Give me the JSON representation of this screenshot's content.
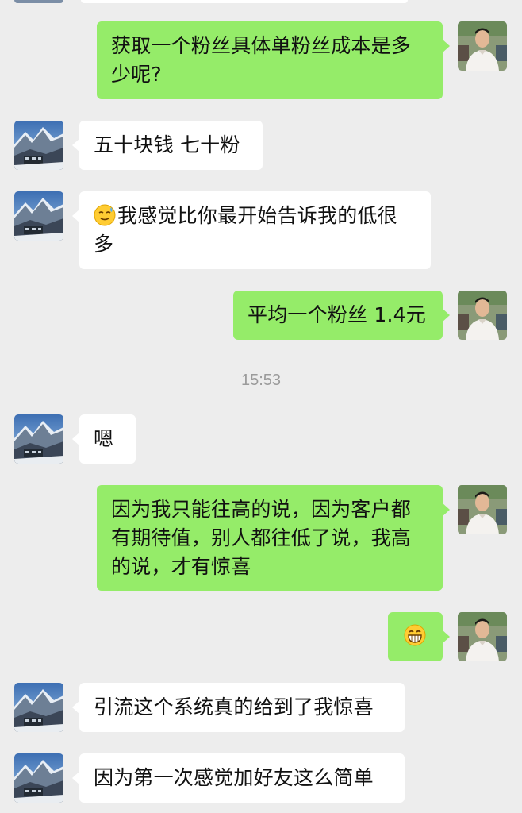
{
  "timestamp": "15:53",
  "messages": [
    {
      "side": "out",
      "text": "获取一个粉丝具体单粉丝成本是多少呢?"
    },
    {
      "side": "in",
      "text": "五十块钱 七十粉"
    },
    {
      "side": "in",
      "emoji": "sweat-smile-emoji",
      "text": "我感觉比你最开始告诉我的低很多"
    },
    {
      "side": "out",
      "text": "平均一个粉丝 1.4元"
    },
    {
      "side": "in",
      "text": "嗯"
    },
    {
      "side": "out",
      "text": "因为我只能往高的说，因为客户都有期待值，别人都往低了说，我高的说，才有惊喜"
    },
    {
      "side": "out",
      "emoji": "grinning-emoji",
      "text": ""
    },
    {
      "side": "in",
      "text": "引流这个系统真的给到了我惊喜"
    },
    {
      "side": "in",
      "text": "因为第一次感觉加好友这么简单"
    }
  ],
  "colors": {
    "background": "#ededed",
    "incoming_bubble": "#ffffff",
    "outgoing_bubble": "#95ec69",
    "timestamp_text": "#9b9b9b"
  }
}
